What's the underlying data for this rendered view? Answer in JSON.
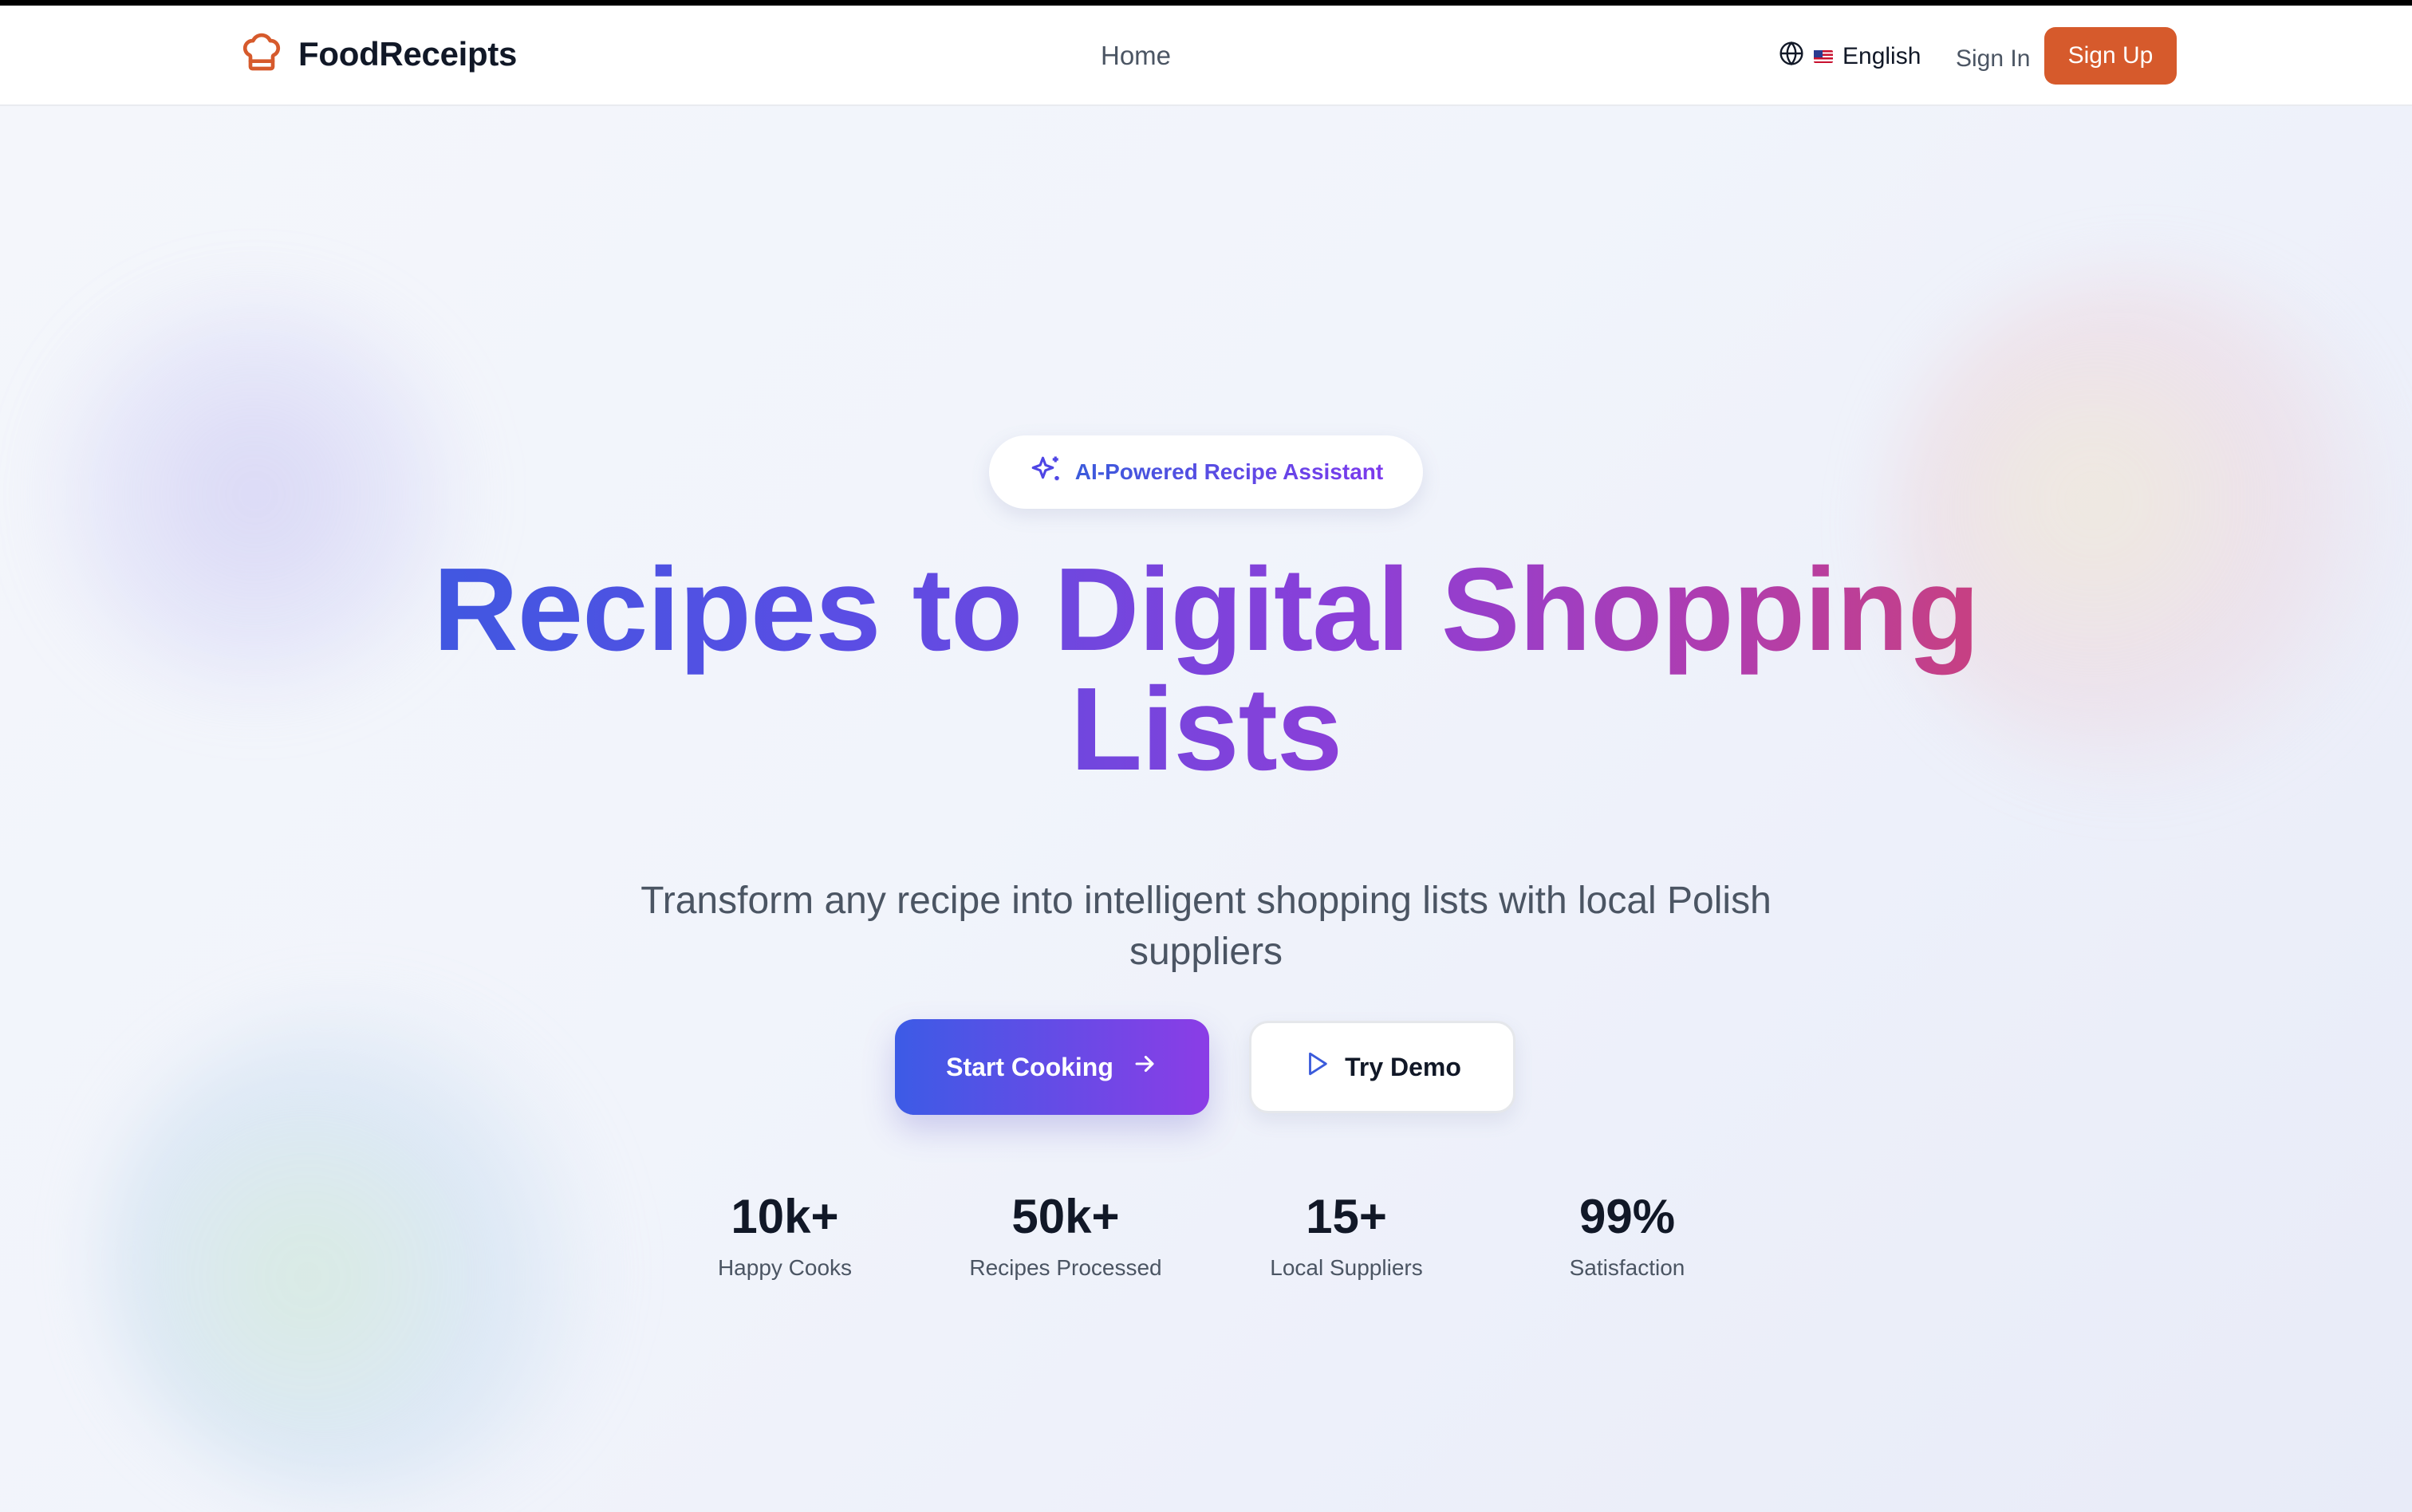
{
  "brand": {
    "name": "FoodReceipts",
    "logo_icon": "chef-hat-icon",
    "accent": "#d65a2c"
  },
  "nav": {
    "home": "Home",
    "language": {
      "flag": "🇺🇸",
      "label": "English",
      "icon": "globe-icon"
    },
    "sign_in": "Sign In",
    "sign_up": "Sign Up"
  },
  "hero": {
    "badge": {
      "icon": "sparkles-icon",
      "label": "AI-Powered Recipe Assistant"
    },
    "title": "Recipes to Digital Shopping Lists",
    "subtitle": "Transform any recipe into intelligent shopping lists with local Polish suppliers",
    "primary_button": {
      "label": "Start Cooking",
      "icon": "arrow-right-icon"
    },
    "secondary_button": {
      "label": "Try Demo",
      "icon": "play-icon"
    }
  },
  "stats": [
    {
      "value": "10k+",
      "label": "Happy Cooks"
    },
    {
      "value": "50k+",
      "label": "Recipes Processed"
    },
    {
      "value": "15+",
      "label": "Local Suppliers"
    },
    {
      "value": "99%",
      "label": "Satisfaction"
    }
  ]
}
